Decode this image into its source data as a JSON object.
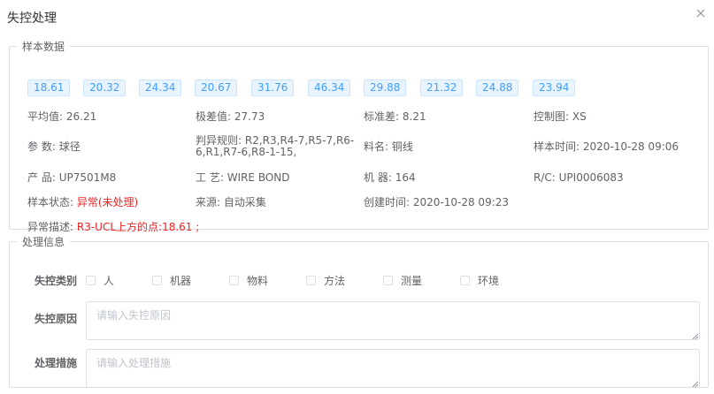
{
  "dialog": {
    "title": "失控处理"
  },
  "sample": {
    "legend": "样本数据",
    "values": [
      "18.61",
      "20.32",
      "24.34",
      "20.67",
      "31.76",
      "46.34",
      "29.88",
      "21.32",
      "24.88",
      "23.94"
    ],
    "mean_label": "平均值:",
    "mean_value": "26.21",
    "range_label": "极差值:",
    "range_value": "27.73",
    "std_label": "标准差:",
    "std_value": "8.21",
    "chart_label": "控制图:",
    "chart_value": "XS",
    "param_label": "参 数:",
    "param_value": "球径",
    "rules_label": "判异规则:",
    "rules_value": "R2,R3,R4-7,R5-7,R6-6,R1,R7-6,R8-1-15,",
    "material_label": "料名:",
    "material_value": "铜线",
    "sample_time_label": "样本时间:",
    "sample_time_value": "2020-10-28 09:06",
    "product_label": "产 品:",
    "product_value": "UP7501M8",
    "process_label": "工 艺:",
    "process_value": "WIRE BOND",
    "machine_label": "机 器:",
    "machine_value": "164",
    "rc_label": "R/C:",
    "rc_value": "UPI0006083",
    "state_label": "样本状态:",
    "state_value": "异常(未处理)",
    "source_label": "来源:",
    "source_value": "自动采集",
    "created_label": "创建时间:",
    "created_value": "2020-10-28 09:23",
    "anomaly_label": "异常描述:",
    "anomaly_value": "R3-UCL上方的点:18.61 ;"
  },
  "handling": {
    "legend": "处理信息",
    "category_label": "失控类别",
    "categories": [
      "人",
      "机器",
      "物料",
      "方法",
      "测量",
      "环境"
    ],
    "cause_label": "失控原因",
    "cause_placeholder": "请输入失控原因",
    "measure_label": "处理措施",
    "measure_placeholder": "请输入处理措施"
  },
  "colors": {
    "accent": "#409eff",
    "chip_bg": "#e8f4ff",
    "error": "#f02323",
    "border": "#dcdfe6"
  },
  "icons": {
    "close": "close-icon"
  }
}
